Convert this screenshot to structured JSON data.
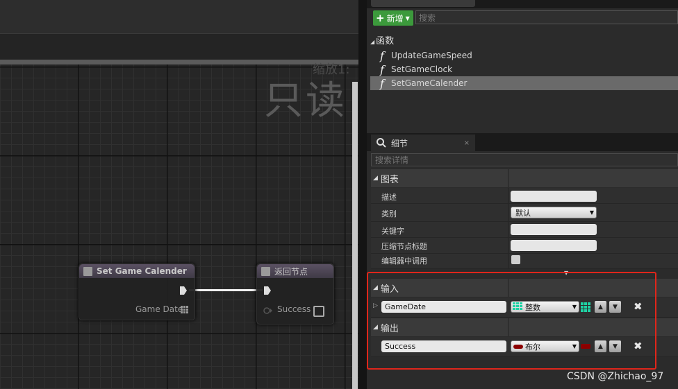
{
  "graph": {
    "zoom_label": "缩放1:",
    "readonly_label": "只读",
    "nodes": [
      {
        "title": "Set Game Calender",
        "pin_label": "Game Date"
      },
      {
        "title": "返回节点",
        "pin_label": "Success"
      }
    ]
  },
  "functions_panel": {
    "new_button": "新增",
    "search_placeholder": "搜索",
    "section_title": "函数",
    "items": [
      {
        "label": "UpdateGameSpeed",
        "selected": false
      },
      {
        "label": "SetGameClock",
        "selected": false
      },
      {
        "label": "SetGameCalender",
        "selected": true
      }
    ]
  },
  "details_panel": {
    "tab_label": "细节",
    "search_placeholder": "搜索详情",
    "graph_section": {
      "title": "图表",
      "rows": [
        {
          "label": "描述",
          "value": ""
        },
        {
          "label": "类别",
          "value": "默认"
        },
        {
          "label": "关键字",
          "value": ""
        },
        {
          "label": "压缩节点标题",
          "value": ""
        },
        {
          "label": "编辑器中调用",
          "checked": false
        }
      ]
    },
    "inputs_section": {
      "title": "输入",
      "param_name": "GameDate",
      "param_type": "整数"
    },
    "outputs_section": {
      "title": "输出",
      "param_name": "Success",
      "param_type": "布尔"
    }
  },
  "watermark": "CSDN @Zhichao_97",
  "colors": {
    "accent_green": "#3c9a3c",
    "highlight_red": "#e0261b",
    "integer_type": "#1fd3a5",
    "bool_type": "#8b0000"
  }
}
